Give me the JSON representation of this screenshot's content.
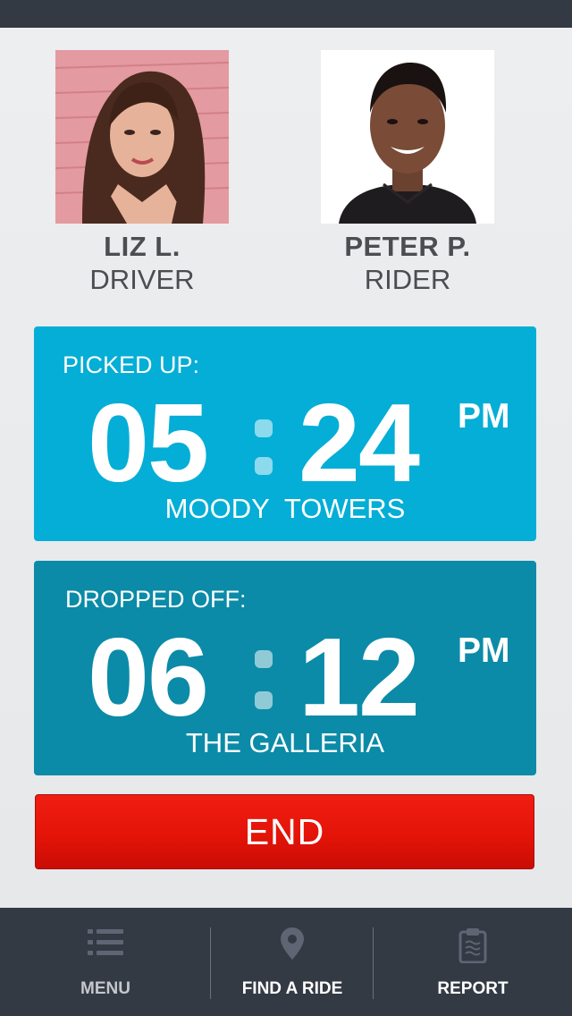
{
  "driver": {
    "name": "LIZ L.",
    "role": "DRIVER"
  },
  "rider": {
    "name": "PETER P.",
    "role": "RIDER"
  },
  "pickup": {
    "label": "PICKED UP:",
    "hour": "05",
    "minute": "24",
    "ampm": "PM",
    "place": "MOODY  TOWERS"
  },
  "dropoff": {
    "label": "DROPPED OFF:",
    "hour": "06",
    "minute": "12",
    "ampm": "PM",
    "place": "THE GALLERIA"
  },
  "end_button": {
    "label": "END"
  },
  "tabbar": {
    "items": [
      {
        "label": "MENU",
        "icon": "list-icon"
      },
      {
        "label": "FIND A RIDE",
        "icon": "location-pin-icon"
      },
      {
        "label": "REPORT",
        "icon": "clipboard-icon"
      }
    ]
  },
  "colors": {
    "pickup_card": "#04aed6",
    "dropoff_card": "#0b8ba7",
    "end_button": "#e41408",
    "bars": "#343a44"
  }
}
